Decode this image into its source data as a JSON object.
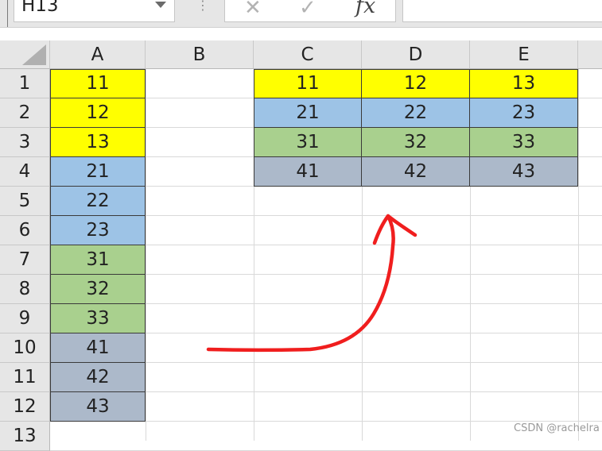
{
  "formula_bar": {
    "name_box": "H13",
    "separator": "⋮",
    "cancel_icon": "close-icon",
    "enter_icon": "check-icon",
    "fx_label": "fx",
    "formula_value": ""
  },
  "columns": [
    "A",
    "B",
    "C",
    "D",
    "E"
  ],
  "rows": [
    "1",
    "2",
    "3",
    "4",
    "5",
    "6",
    "7",
    "8",
    "9",
    "10",
    "11",
    "12",
    "13"
  ],
  "column_a": [
    "11",
    "12",
    "13",
    "21",
    "22",
    "23",
    "31",
    "32",
    "33",
    "41",
    "42",
    "43"
  ],
  "table_cde": [
    [
      "11",
      "12",
      "13"
    ],
    [
      "21",
      "22",
      "23"
    ],
    [
      "31",
      "32",
      "33"
    ],
    [
      "41",
      "42",
      "43"
    ]
  ],
  "colors": {
    "yellow": "#ffff00",
    "blue": "#9dc3e6",
    "green": "#a9d08e",
    "gray": "#acb9ca",
    "arrow": "#ff0000"
  },
  "watermark": "CSDN @rachelra"
}
